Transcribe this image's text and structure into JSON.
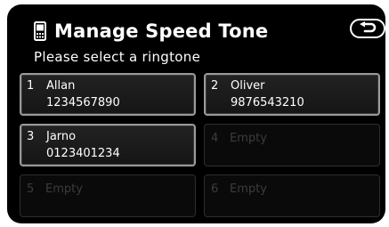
{
  "header": {
    "title": "Manage Speed Tone",
    "subtitle": "Please select a ringtone"
  },
  "slots": [
    {
      "number": "1",
      "name": "Allan",
      "phone": "1234567890"
    },
    {
      "number": "2",
      "name": "Oliver",
      "phone": "9876543210"
    },
    {
      "number": "3",
      "name": "Jarno",
      "phone": "0123401234"
    },
    {
      "number": "4",
      "name": "Empty",
      "phone": ""
    },
    {
      "number": "5",
      "name": "Empty",
      "phone": ""
    },
    {
      "number": "6",
      "name": "Empty",
      "phone": ""
    }
  ],
  "icons": {
    "title_icon": "phone-icon",
    "back_icon": "return-arrow-icon"
  },
  "colors": {
    "background": "#000000",
    "text": "#ffffff",
    "active_border": "#9a9a9a",
    "disabled_text": "#3c3c3c"
  }
}
